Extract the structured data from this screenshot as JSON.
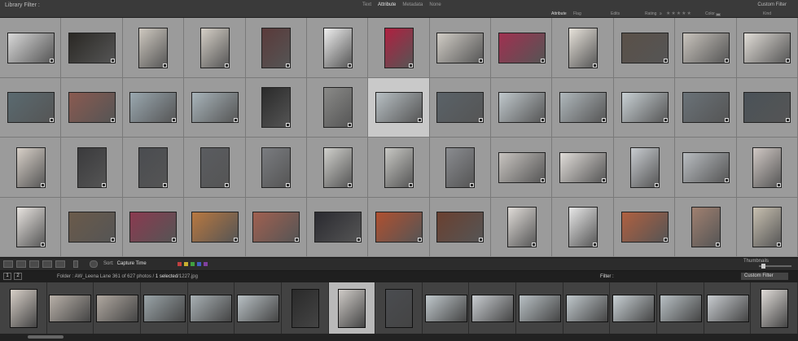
{
  "library_filter": {
    "title": "Library Filter :",
    "tabs": [
      "Text",
      "Attribute",
      "Metadata",
      "None"
    ],
    "active_tab": "Attribute",
    "preset": "Custom Filter",
    "attribute_label": "Attribute",
    "flag_label": "Flag",
    "edits_label": "Edits",
    "rating_label": "Rating",
    "rating_op": "≥",
    "rating_stars": "★★★★★",
    "color_label": "Color",
    "kind_label": "Kind",
    "colors": [
      "#c04040",
      "#c8b030",
      "#40a040",
      "#4060c0",
      "#8040a0",
      "#888888"
    ]
  },
  "grid": {
    "columns": 13,
    "rows": [
      [
        "#d8d8d8",
        "#2a2824",
        "#cfc9c0",
        "#d5cfc6",
        "#5a3a3a",
        "#efefef",
        "#b02040",
        "#d0ccc5",
        "#a03050",
        "#e8e3db",
        "#5a5048",
        "#c8c3bc",
        "#e0dcd6"
      ],
      [
        "#5a6a70",
        "#8a5a50",
        "#9aa8b0",
        "#a8b4ba",
        "#2a2a2a",
        "#8a8a88",
        "#b8c0c4",
        "#5a6268",
        "#c0c8cc",
        "#b0b8bc",
        "#c8d0d4",
        "#6a7278",
        "#4a5258"
      ],
      [
        "#d8d0c8",
        "#3a3a3c",
        "#4a4c50",
        "#5a5c60",
        "#7a7c80",
        "#d0d0cc",
        "#c8c8c4",
        "#8a8c90",
        "#c8c4c0",
        "#e0dcd8",
        "#c8ccd0",
        "#b8bcc0",
        "#d0c8c4"
      ],
      [
        "#e8e4e0",
        "#6a5a4a",
        "#8a3a50",
        "#b87840",
        "#a06050",
        "#2a2a30",
        "#b05030",
        "#6a4030",
        "#e0dcd8",
        "#e8e8e8",
        "#b06040",
        "#a08070",
        "#c8c0b0"
      ]
    ],
    "orientation": [
      [
        "l",
        "l",
        "p",
        "p",
        "p",
        "p",
        "p",
        "l",
        "l",
        "p",
        "l",
        "l",
        "l"
      ],
      [
        "l",
        "l",
        "l",
        "l",
        "p",
        "p",
        "l",
        "l",
        "l",
        "l",
        "l",
        "l",
        "l"
      ],
      [
        "p",
        "p",
        "p",
        "p",
        "p",
        "p",
        "p",
        "p",
        "l",
        "l",
        "p",
        "l",
        "p"
      ],
      [
        "p",
        "l",
        "l",
        "l",
        "l",
        "l",
        "l",
        "l",
        "p",
        "p",
        "l",
        "p",
        "p"
      ]
    ],
    "selected": {
      "row": 1,
      "col": 6
    }
  },
  "toolbar": {
    "sort_label": "Sort:",
    "sort_value": "Capture Time",
    "thumbnails_label": "Thumbnails",
    "label_colors": [
      "#c04040",
      "#c8b030",
      "#40a040",
      "#4060c0",
      "#8040a0"
    ]
  },
  "filmstrip_header": {
    "monitor_1": "1",
    "monitor_2": "2",
    "folder": "Folder : AW_Leena Lane",
    "count": "361 of 627 photos /",
    "selected": "1 selected",
    "file": "/1227.jpg",
    "filter_label": "Filter :",
    "filter_preset": "Custom Filter"
  },
  "filmstrip": {
    "colors": [
      "#d8d0c8",
      "#b8b0a8",
      "#b0a8a0",
      "#9aa4a8",
      "#a8b0b4",
      "#b8c0c4",
      "#2a2a2a",
      "#d0ccc8",
      "#4a4c50",
      "#c0c8cc",
      "#c8ccd0",
      "#b8c0c4",
      "#c0c8cc",
      "#c8d0d4",
      "#b8c0c4",
      "#c8ccd0",
      "#e0dcd8"
    ],
    "orientation": [
      "p",
      "l",
      "l",
      "l",
      "l",
      "l",
      "p",
      "p",
      "p",
      "l",
      "l",
      "l",
      "l",
      "l",
      "l",
      "l",
      "p"
    ],
    "selected": 7
  }
}
